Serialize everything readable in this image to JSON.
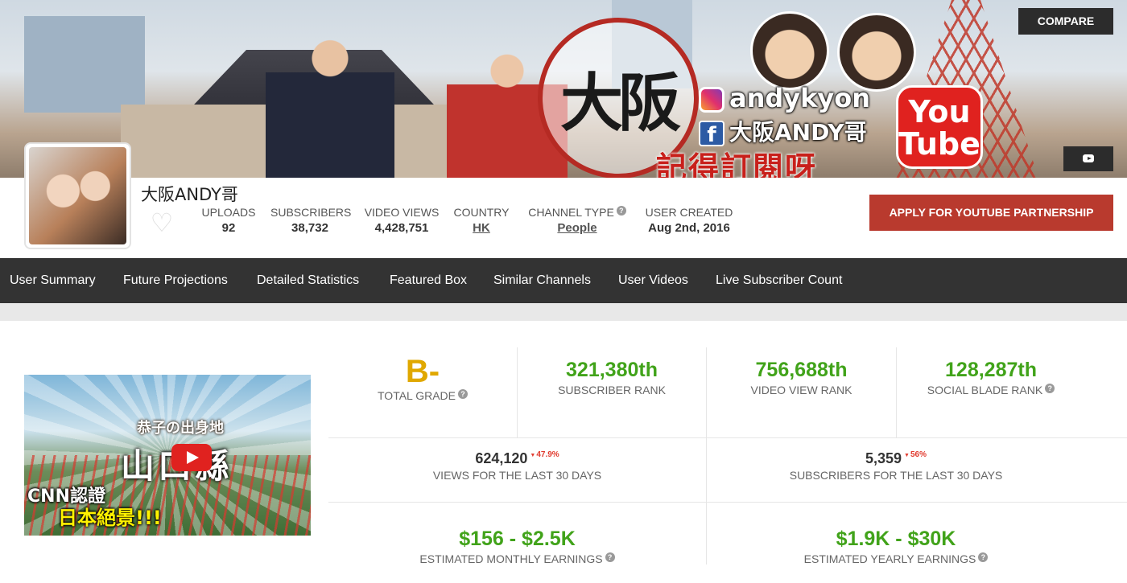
{
  "banner": {
    "logo_text": "大阪",
    "instagram_handle": "andykyon",
    "facebook_name": "大阪ANDY哥",
    "youtube_logo_line1": "You",
    "youtube_logo_line2": "Tube",
    "tagline": "記得訂閱呀"
  },
  "header": {
    "compare_label": "COMPARE",
    "channel_name": "大阪ANDY哥",
    "partner_label": "APPLY FOR YOUTUBE PARTNERSHIP",
    "stats": {
      "uploads": {
        "label": "UPLOADS",
        "value": "92"
      },
      "subscribers": {
        "label": "SUBSCRIBERS",
        "value": "38,732"
      },
      "video_views": {
        "label": "VIDEO VIEWS",
        "value": "4,428,751"
      },
      "country": {
        "label": "COUNTRY",
        "value": "HK"
      },
      "channel_type": {
        "label": "CHANNEL TYPE",
        "value": "People"
      },
      "user_created": {
        "label": "USER CREATED",
        "value": "Aug 2nd, 2016"
      }
    }
  },
  "nav": {
    "items": [
      {
        "label": "User Summary"
      },
      {
        "label": "Future Projections"
      },
      {
        "label": "Detailed Statistics"
      },
      {
        "label": "Featured Box"
      },
      {
        "label": "Similar Channels"
      },
      {
        "label": "User Videos"
      },
      {
        "label": "Live Subscriber Count"
      }
    ]
  },
  "thumbnail": {
    "caption_top": "恭子の出身地",
    "caption_main": "山口縣",
    "caption_left": "CNN認證",
    "caption_bottom": "日本絕景!!!"
  },
  "summary": {
    "grade": {
      "value": "B-",
      "label": "TOTAL GRADE"
    },
    "subscriber_rank": {
      "value": "321,380th",
      "label": "SUBSCRIBER RANK"
    },
    "video_view_rank": {
      "value": "756,688th",
      "label": "VIDEO VIEW RANK"
    },
    "social_blade_rank": {
      "value": "128,287th",
      "label": "SOCIAL BLADE RANK"
    },
    "views_30": {
      "value": "624,120",
      "change": "47.9%",
      "label": "VIEWS FOR THE LAST 30 DAYS"
    },
    "subs_30": {
      "value": "5,359",
      "change": "56%",
      "label": "SUBSCRIBERS FOR THE LAST 30 DAYS"
    },
    "monthly_earnings": {
      "value": "$156 - $2.5K",
      "label": "ESTIMATED MONTHLY EARNINGS"
    },
    "yearly_earnings": {
      "value": "$1.9K - $30K",
      "label": "ESTIMATED YEARLY EARNINGS"
    }
  },
  "colors": {
    "accent_green": "#41a31a",
    "grade_yellow": "#e0a800",
    "partner_red": "#b93a2e",
    "nav_bg": "#333333"
  }
}
